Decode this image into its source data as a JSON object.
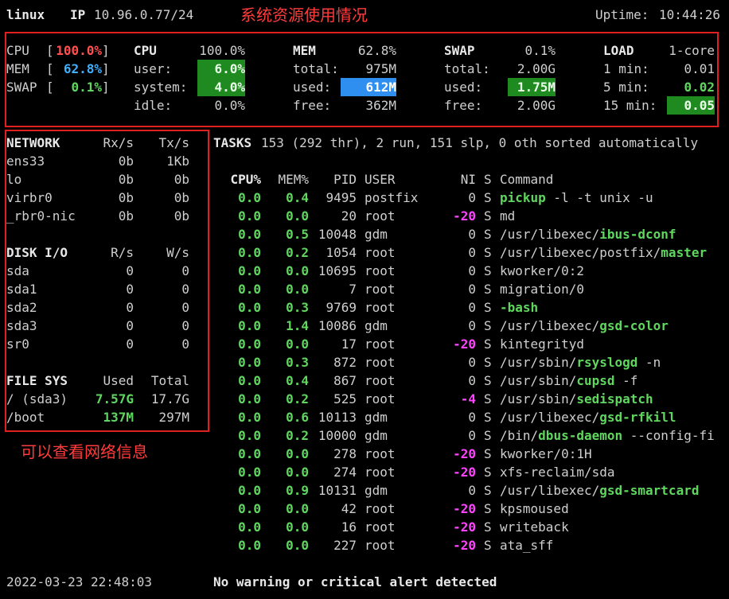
{
  "header": {
    "host": "linux",
    "ip_label": "IP",
    "ip": "10.96.0.77/24",
    "uptime_label": "Uptime:",
    "uptime": "10:44:26"
  },
  "annotations": {
    "top": "系统资源使用情况",
    "left": "可以查看网络信息"
  },
  "quicklook": {
    "cpu": {
      "label": "CPU",
      "value": "100.0%"
    },
    "mem": {
      "label": "MEM",
      "value": "62.8%"
    },
    "swap": {
      "label": "SWAP",
      "value": "0.1%"
    }
  },
  "cpu": {
    "title": "CPU",
    "total": "100.0%",
    "user_label": "user:",
    "user": "6.0%",
    "system_label": "system:",
    "system": "4.0%",
    "idle_label": "idle:",
    "idle": "0.0%"
  },
  "mem": {
    "title": "MEM",
    "total_pct": "62.8%",
    "total_label": "total:",
    "total": "975M",
    "used_label": "used:",
    "used": "612M",
    "free_label": "free:",
    "free": "362M"
  },
  "swap": {
    "title": "SWAP",
    "total_pct": "0.1%",
    "total_label": "total:",
    "total": "2.00G",
    "used_label": "used:",
    "used": "1.75M",
    "free_label": "free:",
    "free": "2.00G"
  },
  "load": {
    "title": "LOAD",
    "cores": "1-core",
    "m1_label": "1 min:",
    "m1": "0.01",
    "m5_label": "5 min:",
    "m5": "0.02",
    "m15_label": "15 min:",
    "m15": "0.05"
  },
  "network": {
    "title": "NETWORK",
    "rx_label": "Rx/s",
    "tx_label": "Tx/s",
    "rows": [
      {
        "name": "ens33",
        "rx": "0b",
        "tx": "1Kb"
      },
      {
        "name": "lo",
        "rx": "0b",
        "tx": "0b"
      },
      {
        "name": "virbr0",
        "rx": "0b",
        "tx": "0b"
      },
      {
        "name": "_rbr0-nic",
        "rx": "0b",
        "tx": "0b"
      }
    ]
  },
  "disk": {
    "title": "DISK I/O",
    "r_label": "R/s",
    "w_label": "W/s",
    "rows": [
      {
        "name": "sda",
        "r": "0",
        "w": "0"
      },
      {
        "name": "sda1",
        "r": "0",
        "w": "0"
      },
      {
        "name": "sda2",
        "r": "0",
        "w": "0"
      },
      {
        "name": "sda3",
        "r": "0",
        "w": "0"
      },
      {
        "name": "sr0",
        "r": "0",
        "w": "0"
      }
    ]
  },
  "fs": {
    "title": "FILE SYS",
    "used_label": "Used",
    "total_label": "Total",
    "rows": [
      {
        "name": "/ (sda3)",
        "used": "7.57G",
        "total": "17.7G"
      },
      {
        "name": "/boot",
        "used": "137M",
        "total": "297M"
      }
    ]
  },
  "tasks": {
    "label": "TASKS",
    "summary": "153 (292 thr), 2 run, 151 slp, 0 oth sorted automatically"
  },
  "proc_headers": {
    "cpu": "CPU%",
    "mem": "MEM%",
    "pid": "PID",
    "user": "USER",
    "ni": "NI",
    "s": "S",
    "cmd": "Command"
  },
  "processes": [
    {
      "cpu": "0.0",
      "mem": "0.4",
      "pid": "9495",
      "user": "postfix",
      "ni": "0",
      "s": "S",
      "pre": "",
      "cmd": "pickup",
      "args": " -l -t unix -u"
    },
    {
      "cpu": "0.0",
      "mem": "0.0",
      "pid": "20",
      "user": "root",
      "ni": "-20",
      "s": "S",
      "pre": "md",
      "cmd": "",
      "args": ""
    },
    {
      "cpu": "0.0",
      "mem": "0.5",
      "pid": "10048",
      "user": "gdm",
      "ni": "0",
      "s": "S",
      "pre": "/usr/libexec/",
      "cmd": "ibus-dconf",
      "args": ""
    },
    {
      "cpu": "0.0",
      "mem": "0.2",
      "pid": "1054",
      "user": "root",
      "ni": "0",
      "s": "S",
      "pre": "/usr/libexec/postfix/",
      "cmd": "master",
      "args": ""
    },
    {
      "cpu": "0.0",
      "mem": "0.0",
      "pid": "10695",
      "user": "root",
      "ni": "0",
      "s": "S",
      "pre": "kworker/0:2",
      "cmd": "",
      "args": ""
    },
    {
      "cpu": "0.0",
      "mem": "0.0",
      "pid": "7",
      "user": "root",
      "ni": "0",
      "s": "S",
      "pre": "migration/0",
      "cmd": "",
      "args": ""
    },
    {
      "cpu": "0.0",
      "mem": "0.3",
      "pid": "9769",
      "user": "root",
      "ni": "0",
      "s": "S",
      "pre": "",
      "cmd": "-bash",
      "args": ""
    },
    {
      "cpu": "0.0",
      "mem": "1.4",
      "pid": "10086",
      "user": "gdm",
      "ni": "0",
      "s": "S",
      "pre": "/usr/libexec/",
      "cmd": "gsd-color",
      "args": ""
    },
    {
      "cpu": "0.0",
      "mem": "0.0",
      "pid": "17",
      "user": "root",
      "ni": "-20",
      "s": "S",
      "pre": "kintegrityd",
      "cmd": "",
      "args": ""
    },
    {
      "cpu": "0.0",
      "mem": "0.3",
      "pid": "872",
      "user": "root",
      "ni": "0",
      "s": "S",
      "pre": "/usr/sbin/",
      "cmd": "rsyslogd",
      "args": " -n"
    },
    {
      "cpu": "0.0",
      "mem": "0.4",
      "pid": "867",
      "user": "root",
      "ni": "0",
      "s": "S",
      "pre": "/usr/sbin/",
      "cmd": "cupsd",
      "args": " -f"
    },
    {
      "cpu": "0.0",
      "mem": "0.2",
      "pid": "525",
      "user": "root",
      "ni": "-4",
      "s": "S",
      "pre": "/usr/sbin/",
      "cmd": "sedispatch",
      "args": ""
    },
    {
      "cpu": "0.0",
      "mem": "0.6",
      "pid": "10113",
      "user": "gdm",
      "ni": "0",
      "s": "S",
      "pre": "/usr/libexec/",
      "cmd": "gsd-rfkill",
      "args": ""
    },
    {
      "cpu": "0.0",
      "mem": "0.2",
      "pid": "10000",
      "user": "gdm",
      "ni": "0",
      "s": "S",
      "pre": "/bin/",
      "cmd": "dbus-daemon",
      "args": " --config-fi"
    },
    {
      "cpu": "0.0",
      "mem": "0.0",
      "pid": "278",
      "user": "root",
      "ni": "-20",
      "s": "S",
      "pre": "kworker/0:1H",
      "cmd": "",
      "args": ""
    },
    {
      "cpu": "0.0",
      "mem": "0.0",
      "pid": "274",
      "user": "root",
      "ni": "-20",
      "s": "S",
      "pre": "xfs-reclaim/sda",
      "cmd": "",
      "args": ""
    },
    {
      "cpu": "0.0",
      "mem": "0.9",
      "pid": "10131",
      "user": "gdm",
      "ni": "0",
      "s": "S",
      "pre": "/usr/libexec/",
      "cmd": "gsd-smartcard",
      "args": ""
    },
    {
      "cpu": "0.0",
      "mem": "0.0",
      "pid": "42",
      "user": "root",
      "ni": "-20",
      "s": "S",
      "pre": "kpsmoused",
      "cmd": "",
      "args": ""
    },
    {
      "cpu": "0.0",
      "mem": "0.0",
      "pid": "16",
      "user": "root",
      "ni": "-20",
      "s": "S",
      "pre": "writeback",
      "cmd": "",
      "args": ""
    },
    {
      "cpu": "0.0",
      "mem": "0.0",
      "pid": "227",
      "user": "root",
      "ni": "-20",
      "s": "S",
      "pre": "ata_sff",
      "cmd": "",
      "args": ""
    }
  ],
  "footer": {
    "datetime": "2022-03-23 22:48:03",
    "alert": "No warning or critical alert detected"
  }
}
